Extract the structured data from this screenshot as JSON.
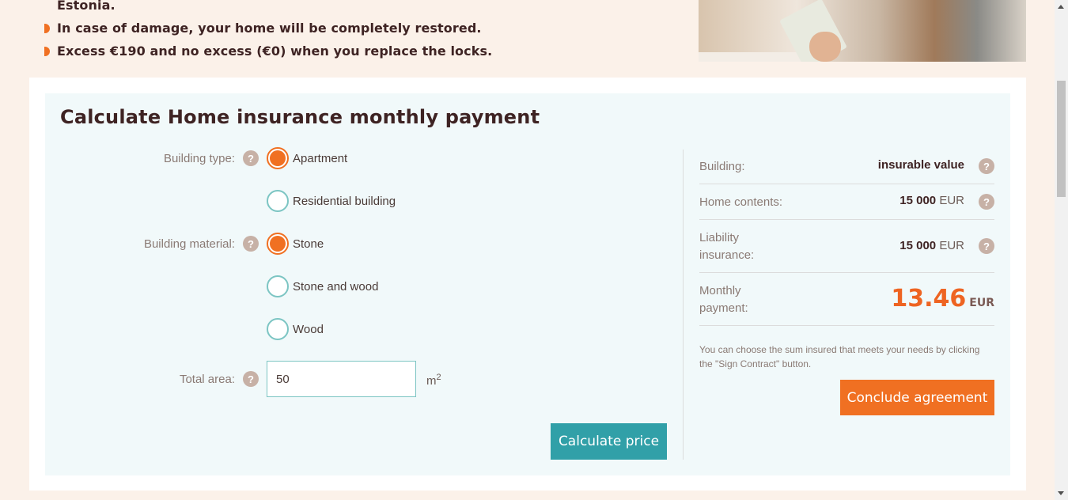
{
  "benefits": [
    "Estonia.",
    "In case of damage, your home will be completely restored.",
    "Excess €190 and no excess (€0) when you replace the locks."
  ],
  "calculator": {
    "title": "Calculate Home insurance monthly payment",
    "building_type_label": "Building type:",
    "building_type_options": [
      "Apartment",
      "Residential building"
    ],
    "building_type_selected": "Apartment",
    "building_material_label": "Building material:",
    "building_material_options": [
      "Stone",
      "Stone and wood",
      "Wood"
    ],
    "building_material_selected": "Stone",
    "total_area_label": "Total area:",
    "total_area_value": "50",
    "total_area_unit": "m",
    "total_area_unit_sup": "2",
    "calculate_button": "Calculate price",
    "help_icon": "?"
  },
  "summary": {
    "building_label": "Building:",
    "building_value": "insurable value",
    "contents_label": "Home contents:",
    "contents_amount": "15 000",
    "contents_currency": "EUR",
    "liability_label": "Liability insurance:",
    "liability_amount": "15 000",
    "liability_currency": "EUR",
    "monthly_label": "Monthly payment:",
    "monthly_amount": "13.46",
    "monthly_currency": "EUR",
    "note": "You can choose the sum insured that meets your needs by clicking the \"Sign Contract\" button.",
    "conclude_button": "Conclude agreement"
  },
  "colors": {
    "accent_orange": "#f07022",
    "accent_teal": "#31a0a8",
    "background": "#fbf1e9"
  }
}
